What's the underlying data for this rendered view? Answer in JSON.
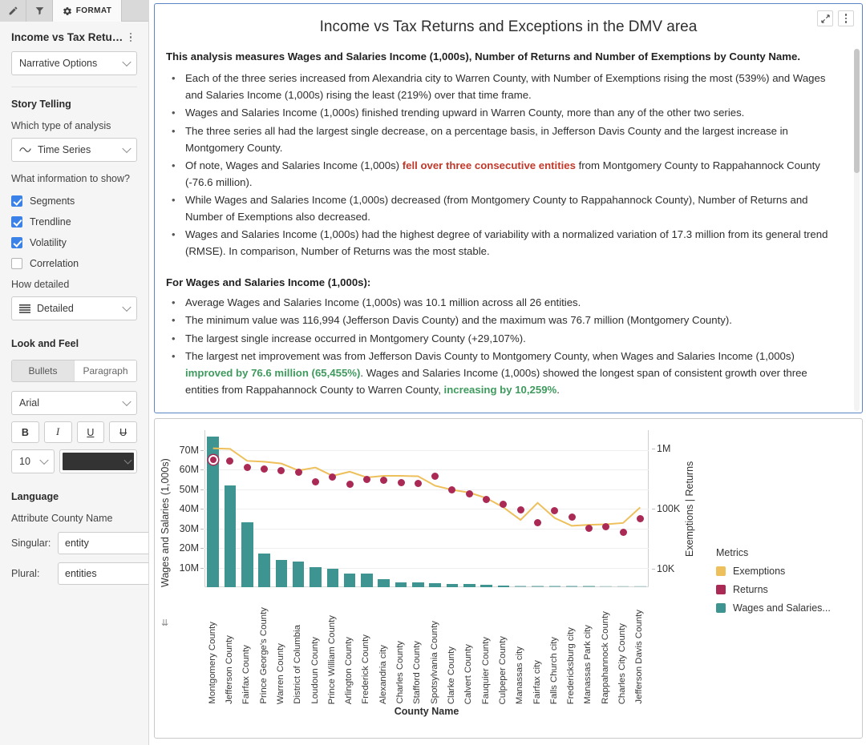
{
  "tabs": [
    {
      "name": "pencil-tab",
      "icon": "pencil-icon",
      "label": ""
    },
    {
      "name": "filter-tab",
      "icon": "filter-icon",
      "label": ""
    },
    {
      "name": "format-tab",
      "icon": "gear-icon",
      "label": "FORMAT"
    }
  ],
  "sidebar": {
    "panel_title": "Income vs Tax Retur...",
    "narrative_options": "Narrative Options",
    "story_telling_heading": "Story Telling",
    "analysis_label": "Which type of analysis",
    "analysis_value": "Time Series",
    "info_label": "What information to show?",
    "checkboxes": [
      {
        "label": "Segments",
        "checked": true
      },
      {
        "label": "Trendline",
        "checked": true
      },
      {
        "label": "Volatility",
        "checked": true
      },
      {
        "label": "Correlation",
        "checked": false
      }
    ],
    "detail_label": "How detailed",
    "detail_value": "Detailed",
    "look_feel_heading": "Look and Feel",
    "format_modes": [
      {
        "label": "Bullets",
        "active": true
      },
      {
        "label": "Paragraph",
        "active": false
      }
    ],
    "font_family": "Arial",
    "font_buttons": [
      {
        "label": "B",
        "name": "bold-button"
      },
      {
        "label": "I",
        "name": "italic-button"
      },
      {
        "label": "U",
        "name": "underline-button"
      },
      {
        "label": "U",
        "name": "strikethrough-button"
      }
    ],
    "font_size": "10",
    "font_color": "#333333",
    "language_heading": "Language",
    "attribute_label": "Attribute County Name",
    "singular_label": "Singular:",
    "singular_value": "entity",
    "plural_label": "Plural:",
    "plural_value": "entities"
  },
  "narrative": {
    "title": "Income vs Tax Returns and Exceptions in the DMV area",
    "lead": "This analysis measures Wages and Salaries Income (1,000s), Number of Returns and Number of Exemptions by County Name.",
    "bullets": [
      {
        "parts": [
          {
            "t": "Each of the three series increased from Alexandria city to Warren County, with Number of Exemptions rising the most (539%) and Wages and Salaries Income (1,000s) rising the least (219%) over that time frame."
          }
        ]
      },
      {
        "parts": [
          {
            "t": "Wages and Salaries Income (1,000s) finished trending upward in Warren County, more than any of the other two series."
          }
        ]
      },
      {
        "parts": [
          {
            "t": "The three series all had the largest single decrease, on a percentage basis, in Jefferson Davis County and the largest increase in Montgomery County."
          }
        ]
      },
      {
        "parts": [
          {
            "t": "Of note, Wages and Salaries Income (1,000s) "
          },
          {
            "t": "fell over three consecutive entities",
            "hl": "red"
          },
          {
            "t": " from Montgomery County to Rappahannock County (-76.6 million)."
          }
        ]
      },
      {
        "parts": [
          {
            "t": "While Wages and Salaries Income (1,000s) decreased (from Montgomery County to Rappahannock County), Number of Returns and Number of Exemptions also decreased."
          }
        ]
      },
      {
        "parts": [
          {
            "t": "Wages and Salaries Income (1,000s) had the highest degree of variability with a normalized variation of 17.3 million from its general trend (RMSE). In comparison, Number of Returns was the most stable."
          }
        ]
      }
    ],
    "section_heading": "For Wages and Salaries Income (1,000s):",
    "section_bullets": [
      {
        "parts": [
          {
            "t": "Average Wages and Salaries Income (1,000s) was 10.1 million across all 26 entities."
          }
        ]
      },
      {
        "parts": [
          {
            "t": "The minimum value was 116,994 (Jefferson Davis County) and the maximum was 76.7 million (Montgomery County)."
          }
        ]
      },
      {
        "parts": [
          {
            "t": "The largest single increase occurred in Montgomery County (+29,107%)."
          }
        ]
      },
      {
        "parts": [
          {
            "t": "The largest net improvement was from Jefferson Davis County to Montgomery County, when Wages and Salaries Income (1,000s) "
          },
          {
            "t": "improved by 76.6 million (65,455%)",
            "hl": "green"
          },
          {
            "t": ". Wages and Salaries Income (1,000s) showed the longest span of consistent growth over three entities from Rappahannock County to Warren County, "
          },
          {
            "t": "increasing by 10,259%",
            "hl": "green"
          },
          {
            "t": "."
          }
        ]
      }
    ]
  },
  "chart_data": {
    "type": "bar",
    "title": "",
    "xlabel": "County Name",
    "ylabel": "Wages and Salaries (1,000s)",
    "ylabel_right": "Exemptions  |  Returns",
    "ylim": [
      0,
      80000000
    ],
    "yticks": [
      10000000,
      20000000,
      30000000,
      40000000,
      50000000,
      60000000,
      70000000
    ],
    "ytick_labels": [
      "10M",
      "20M",
      "30M",
      "40M",
      "50M",
      "60M",
      "70M"
    ],
    "right_axis_scale": "log",
    "right_ticks": [
      10000,
      100000,
      1000000
    ],
    "right_tick_labels": [
      "10K",
      "100K",
      "1M"
    ],
    "grid": true,
    "legend_title": "Metrics",
    "legend_position": "right",
    "categories": [
      "Montgomery County",
      "Jefferson County",
      "Fairfax County",
      "Prince George's County",
      "Warren County",
      "District of Columbia",
      "Loudoun County",
      "Prince William County",
      "Arlington County",
      "Frederick County",
      "Alexandria city",
      "Charles County",
      "Stafford County",
      "Spotsylvania County",
      "Clarke County",
      "Calvert County",
      "Fauquier County",
      "Culpeper County",
      "Manassas city",
      "Fairfax city",
      "Falls Church city",
      "Fredericksburg city",
      "Manassas Park city",
      "Rappahannock County",
      "Charles City County",
      "Jefferson Davis County"
    ],
    "series": [
      {
        "name": "Wages and Salaries...",
        "full_name": "Wages and Salaries Income (1,000s)",
        "color": "#3d9491",
        "render": "bar",
        "axis": "left",
        "values": [
          76700000,
          52000000,
          33000000,
          17000000,
          14000000,
          13000000,
          10200000,
          9500000,
          7000000,
          7000000,
          4000000,
          2600000,
          2300000,
          2000000,
          1800000,
          1700000,
          1300000,
          900000,
          700000,
          650000,
          600000,
          550000,
          450000,
          300000,
          200000,
          116994
        ]
      },
      {
        "name": "Returns",
        "color": "#aa2a55",
        "render": "scatter",
        "axis": "right",
        "values": [
          640000,
          620000,
          480000,
          455000,
          430000,
          400000,
          280000,
          330000,
          255000,
          305000,
          295000,
          270000,
          265000,
          350000,
          205000,
          175000,
          140000,
          120000,
          95000,
          58000,
          92000,
          73000,
          48000,
          50000,
          40000,
          68000
        ]
      },
      {
        "name": "Exemptions",
        "color": "#eec05c",
        "render": "line",
        "axis": "right",
        "values": [
          1000000,
          980000,
          620000,
          600000,
          560000,
          430000,
          480000,
          350000,
          410000,
          330000,
          350000,
          350000,
          345000,
          240000,
          205000,
          185000,
          150000,
          105000,
          65000,
          125000,
          70000,
          52000,
          54000,
          55000,
          58000,
          105000
        ]
      }
    ],
    "selected_point": {
      "series": "Returns",
      "category": "Montgomery County"
    }
  }
}
